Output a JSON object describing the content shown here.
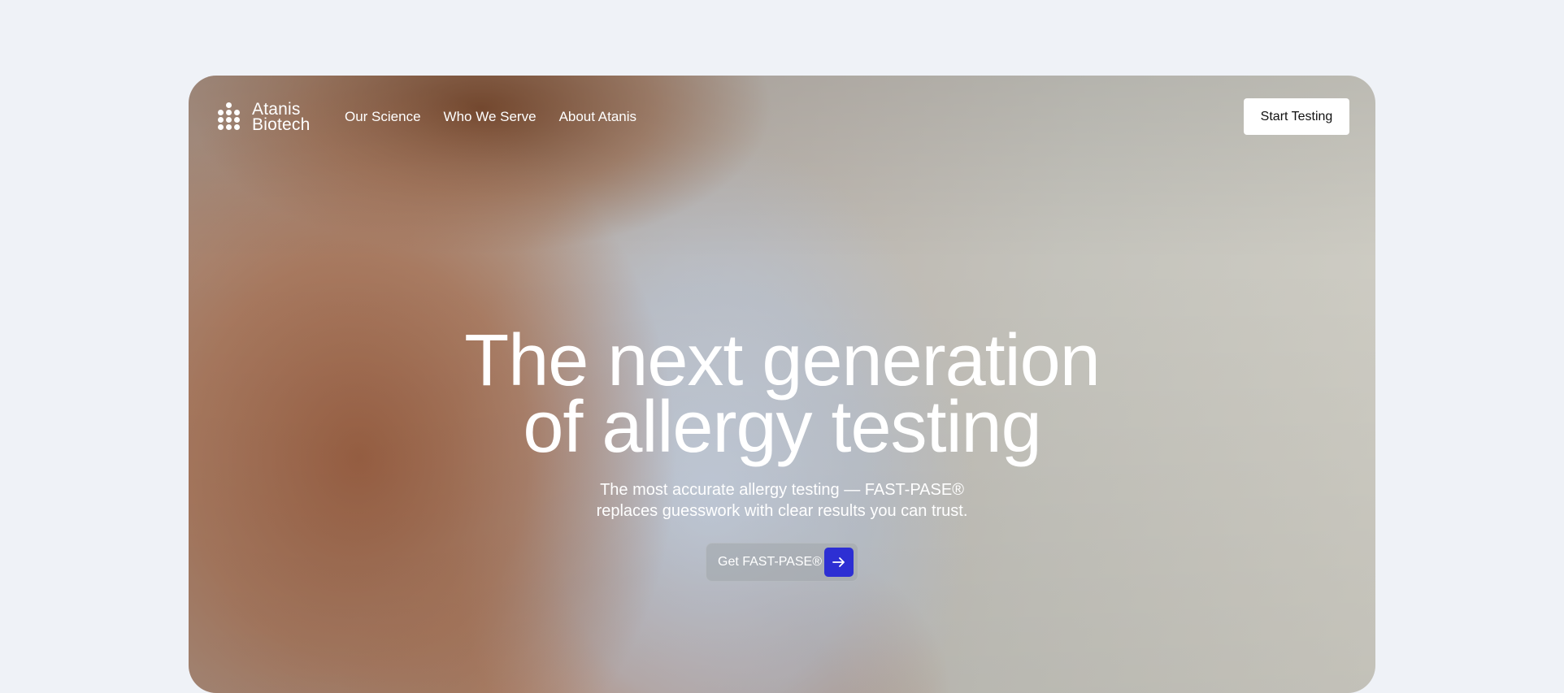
{
  "brand": {
    "name_line1": "Atanis",
    "name_line2": "Biotech"
  },
  "nav": {
    "links": [
      "Our Science",
      "Who We Serve",
      "About Atanis"
    ],
    "cta_label": "Start Testing"
  },
  "hero": {
    "title_line1": "The next generation",
    "title_line2": "of allergy testing",
    "subtitle_line1": "The most accurate allergy testing — FAST-PASE®",
    "subtitle_line2": "replaces guesswork with clear results you can trust.",
    "cta_label": "Get FAST-PASE®",
    "cta_icon": "arrow-right-icon"
  },
  "colors": {
    "page_bg": "#eff2f7",
    "accent": "#2d2fd3",
    "text_light": "#ffffff"
  }
}
